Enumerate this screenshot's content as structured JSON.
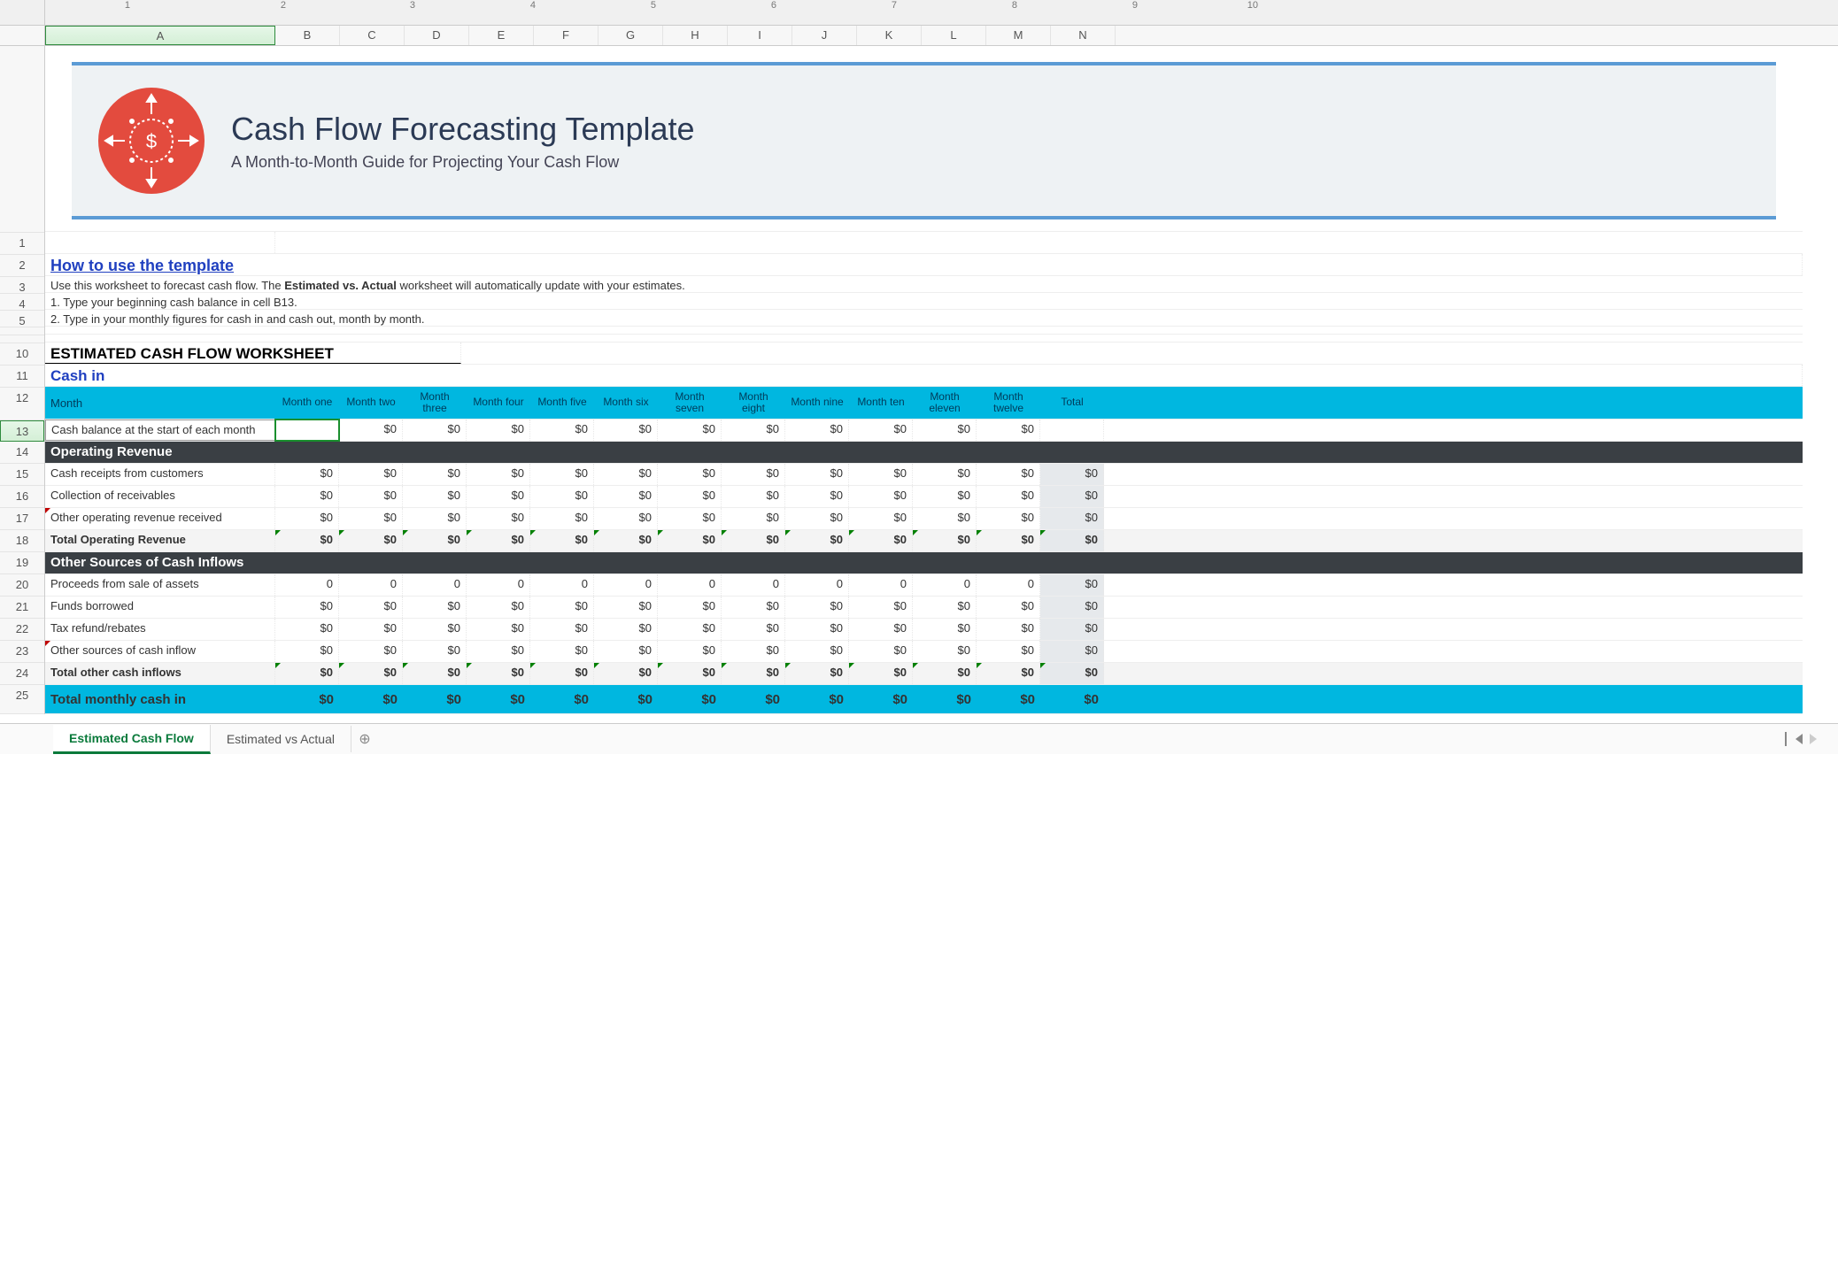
{
  "ruler_numbers": [
    "1",
    "2",
    "3",
    "4",
    "5",
    "6",
    "7",
    "8",
    "9",
    "10"
  ],
  "columns": [
    "A",
    "B",
    "C",
    "D",
    "E",
    "F",
    "G",
    "H",
    "I",
    "J",
    "K",
    "L",
    "M",
    "N"
  ],
  "row_numbers": [
    "1",
    "2",
    "3",
    "4",
    "5",
    "",
    "",
    "10",
    "11",
    "12",
    "13",
    "14",
    "15",
    "16",
    "17",
    "18",
    "19",
    "20",
    "21",
    "22",
    "23",
    "24",
    "25"
  ],
  "banner": {
    "title": "Cash Flow Forecasting Template",
    "subtitle": "A Month-to-Month Guide for Projecting Your Cash Flow"
  },
  "howto": {
    "heading": "How to use the template",
    "line1_pre": "Use this worksheet to forecast cash flow. The ",
    "line1_bold": "Estimated vs. Actual",
    "line1_post": " worksheet will automatically update with your estimates.",
    "line2": "1. Type your beginning cash balance in cell B13.",
    "line3": "2. Type in your monthly figures for cash in and cash out, month by month."
  },
  "worksheet_title": "ESTIMATED CASH FLOW WORKSHEET",
  "cash_in_label": "Cash in",
  "month_header": {
    "label": "Month",
    "months": [
      "Month one",
      "Month two",
      "Month three",
      "Month four",
      "Month five",
      "Month six",
      "Month seven",
      "Month eight",
      "Month nine",
      "Month ten",
      "Month eleven",
      "Month twelve",
      "Total"
    ]
  },
  "rows": {
    "start_balance": {
      "label": "Cash balance at the start of each month",
      "v": [
        "",
        "$0",
        "$0",
        "$0",
        "$0",
        "$0",
        "$0",
        "$0",
        "$0",
        "$0",
        "$0",
        "$0",
        ""
      ]
    },
    "section_op": "Operating Revenue",
    "op1": {
      "label": "Cash receipts from customers",
      "v": [
        "$0",
        "$0",
        "$0",
        "$0",
        "$0",
        "$0",
        "$0",
        "$0",
        "$0",
        "$0",
        "$0",
        "$0",
        "$0"
      ]
    },
    "op2": {
      "label": "Collection of receivables",
      "v": [
        "$0",
        "$0",
        "$0",
        "$0",
        "$0",
        "$0",
        "$0",
        "$0",
        "$0",
        "$0",
        "$0",
        "$0",
        "$0"
      ]
    },
    "op3": {
      "label": "Other operating revenue received",
      "v": [
        "$0",
        "$0",
        "$0",
        "$0",
        "$0",
        "$0",
        "$0",
        "$0",
        "$0",
        "$0",
        "$0",
        "$0",
        "$0"
      ]
    },
    "op_total": {
      "label": "Total Operating Revenue",
      "v": [
        "$0",
        "$0",
        "$0",
        "$0",
        "$0",
        "$0",
        "$0",
        "$0",
        "$0",
        "$0",
        "$0",
        "$0",
        "$0"
      ]
    },
    "section_other": "Other Sources of Cash Inflows",
    "ot1": {
      "label": "Proceeds from sale of assets",
      "v": [
        "0",
        "0",
        "0",
        "0",
        "0",
        "0",
        "0",
        "0",
        "0",
        "0",
        "0",
        "0",
        "$0"
      ]
    },
    "ot2": {
      "label": "Funds borrowed",
      "v": [
        "$0",
        "$0",
        "$0",
        "$0",
        "$0",
        "$0",
        "$0",
        "$0",
        "$0",
        "$0",
        "$0",
        "$0",
        "$0"
      ]
    },
    "ot3": {
      "label": "Tax refund/rebates",
      "v": [
        "$0",
        "$0",
        "$0",
        "$0",
        "$0",
        "$0",
        "$0",
        "$0",
        "$0",
        "$0",
        "$0",
        "$0",
        "$0"
      ]
    },
    "ot4": {
      "label": "Other sources of cash inflow",
      "v": [
        "$0",
        "$0",
        "$0",
        "$0",
        "$0",
        "$0",
        "$0",
        "$0",
        "$0",
        "$0",
        "$0",
        "$0",
        "$0"
      ]
    },
    "ot_total": {
      "label": "Total other cash inflows",
      "v": [
        "$0",
        "$0",
        "$0",
        "$0",
        "$0",
        "$0",
        "$0",
        "$0",
        "$0",
        "$0",
        "$0",
        "$0",
        "$0"
      ]
    },
    "grand": {
      "label": "Total monthly cash in",
      "v": [
        "$0",
        "$0",
        "$0",
        "$0",
        "$0",
        "$0",
        "$0",
        "$0",
        "$0",
        "$0",
        "$0",
        "$0",
        "$0"
      ]
    }
  },
  "tabs": {
    "active": "Estimated Cash Flow",
    "t2": "Estimated vs Actual"
  }
}
